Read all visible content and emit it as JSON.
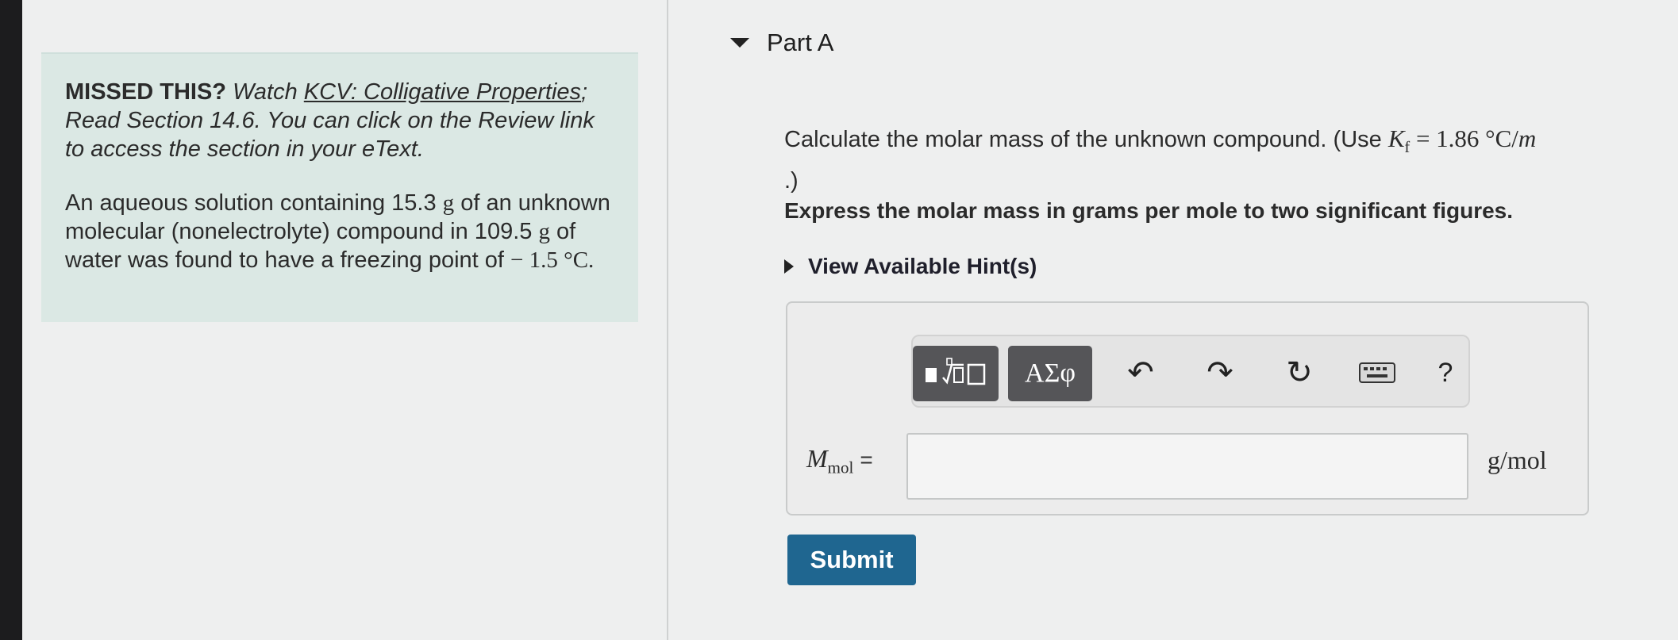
{
  "info": {
    "missed_label": "MISSED THIS?",
    "watch_text": " Watch ",
    "kcv_link": "KCV: Colligative Properties",
    "read_text": "; Read Section 14.6. You can click on the Review link to access the section in your eText.",
    "problem_part1": "An aqueous solution containing 15.3 ",
    "problem_unit_g1": "g",
    "problem_part2": " of an unknown molecular (nonelectrolyte) compound in 109.5 ",
    "problem_unit_g2": "g",
    "problem_part3": " of water was found to have a freezing point of ",
    "problem_temp": "− 1.5 °C."
  },
  "part": {
    "title": "Part A"
  },
  "question": {
    "text_prefix": "Calculate the molar mass of the unknown compound. (Use ",
    "kf_symbol": "K",
    "kf_sub": "f",
    "kf_value": " = 1.86 °C/",
    "kf_m": "m",
    "text_suffix": ".)",
    "instruction": "Express the molar mass in grams per mole to two significant figures.",
    "hints_label": "View Available Hint(s)"
  },
  "toolbar": {
    "symbols_label": "ΑΣφ",
    "undo_glyph": "↶",
    "redo_glyph": "↷",
    "reset_glyph": "↻",
    "help_glyph": "?"
  },
  "answer": {
    "var_symbol": "M",
    "var_sub": "mol",
    "equals": "=",
    "value": "",
    "unit": "g/mol"
  },
  "submit_label": "Submit"
}
